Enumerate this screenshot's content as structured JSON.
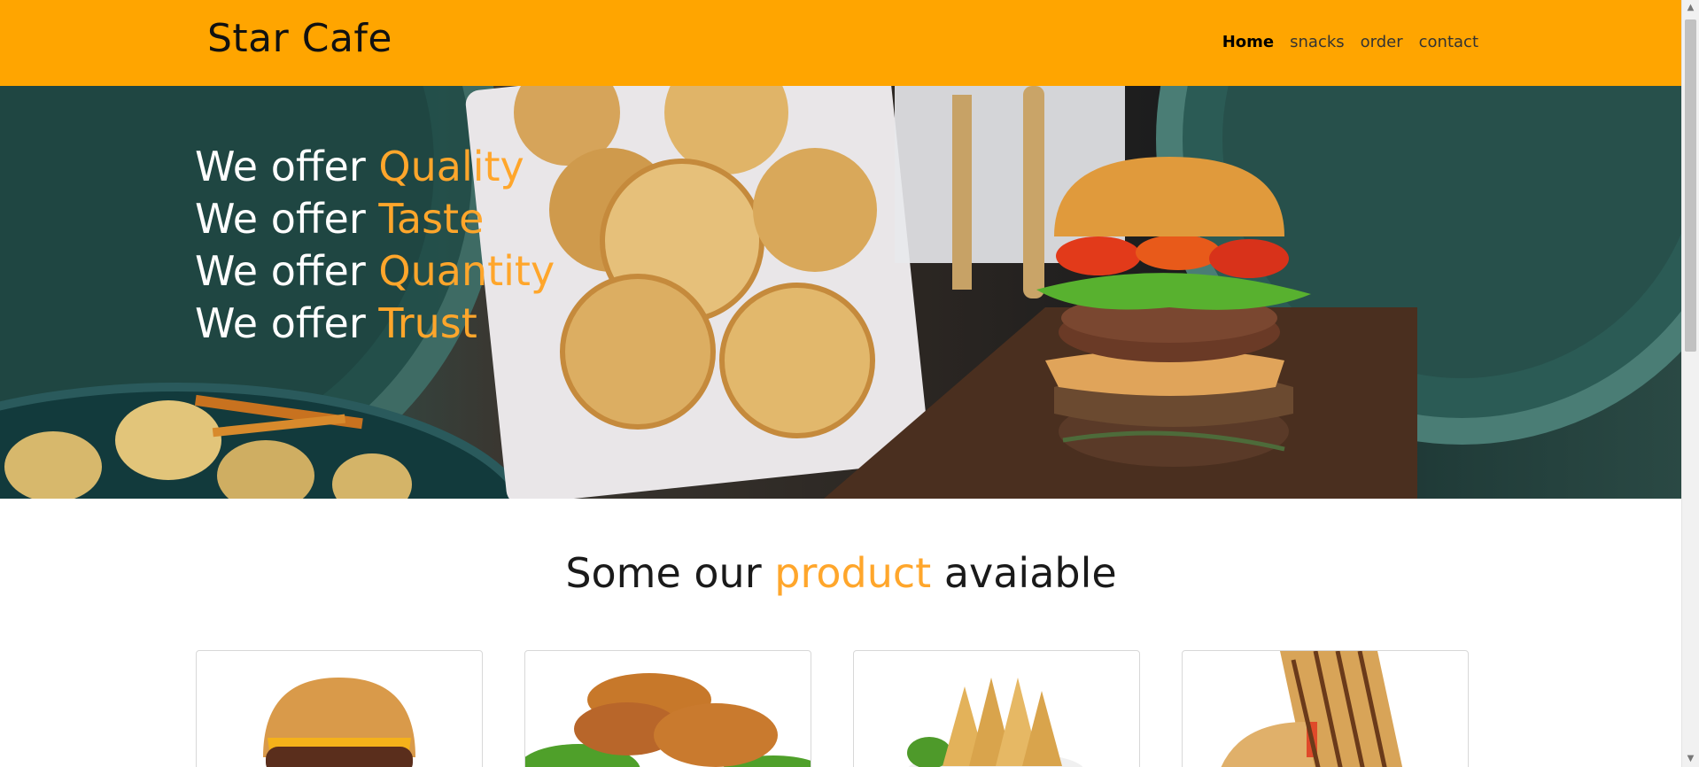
{
  "brand": "Star Cafe",
  "nav": {
    "home": "Home",
    "snacks": "snacks",
    "order": "order",
    "contact": "contact"
  },
  "hero": {
    "prefix": "We offer",
    "lines": [
      {
        "word": "Quality"
      },
      {
        "word": "Taste"
      },
      {
        "word": "Quantity"
      },
      {
        "word": "Trust"
      }
    ]
  },
  "products": {
    "title_start": "Some our",
    "title_accent": "product",
    "title_end": "avaiable",
    "items": [
      "burger",
      "patties",
      "samosa",
      "sandwich"
    ]
  },
  "colors": {
    "header": "#ffa500",
    "accent": "#ffa62b"
  }
}
